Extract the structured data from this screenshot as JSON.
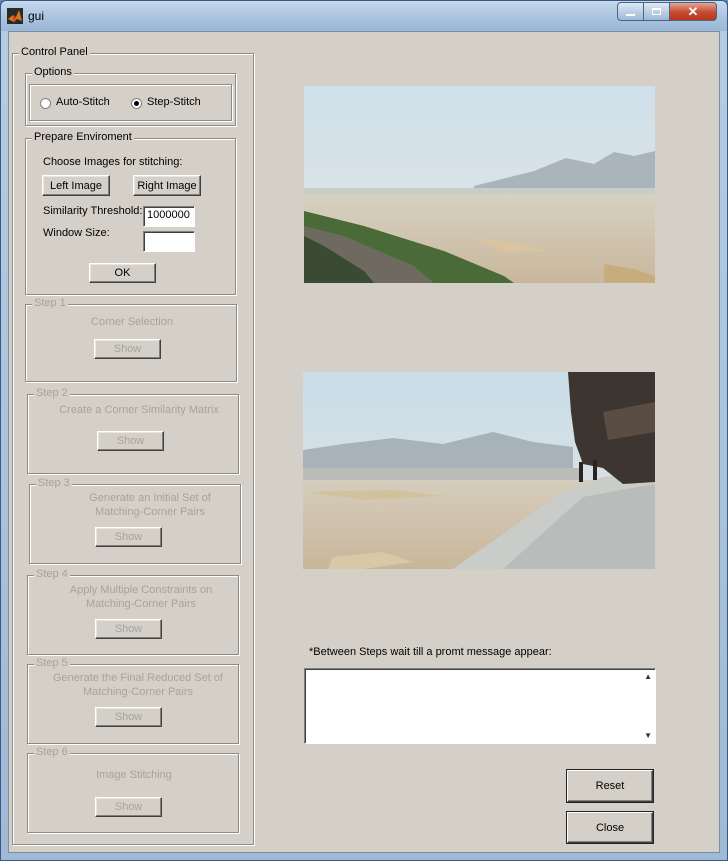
{
  "window": {
    "title": "gui"
  },
  "control_panel": {
    "title": "Control Panel"
  },
  "options": {
    "title": "Options",
    "radio_auto": "Auto-Stitch",
    "radio_step": "Step-Stitch",
    "selected": "Step-Stitch"
  },
  "prepare": {
    "title": "Prepare Enviroment",
    "choose_label": "Choose Images for stitching:",
    "left_button": "Left Image",
    "right_button": "Right Image",
    "threshold_label": "Similarity Threshold:",
    "threshold_value": "1000000",
    "window_size_label": "Window Size:",
    "window_size_value": "",
    "ok_button": "OK"
  },
  "steps": [
    {
      "title": "Step 1",
      "description": "Corner Selection",
      "button": "Show"
    },
    {
      "title": "Step 2",
      "description": "Create a Corner Similarity Matrix",
      "button": "Show"
    },
    {
      "title": "Step 3",
      "description": "Generate an Initial Set of Matching-Corner Pairs",
      "button": "Show"
    },
    {
      "title": "Step 4",
      "description": "Apply Multiple Constraints on Matching-Corner Pairs",
      "button": "Show"
    },
    {
      "title": "Step 5",
      "description": "Generate the Final Reduced Set of Matching-Corner Pairs",
      "button": "Show"
    },
    {
      "title": "Step 6",
      "description": "Image Stitching",
      "button": "Show"
    }
  ],
  "note": "*Between Steps wait till a promt message appear:",
  "message_box": {
    "value": ""
  },
  "buttons": {
    "reset": "Reset",
    "close": "Close"
  },
  "colors": {
    "panel_bg": "#d4d0c8",
    "disabled_text": "#a6a39c",
    "title_bar": "#aac3df",
    "close_button": "#c54a2e"
  }
}
